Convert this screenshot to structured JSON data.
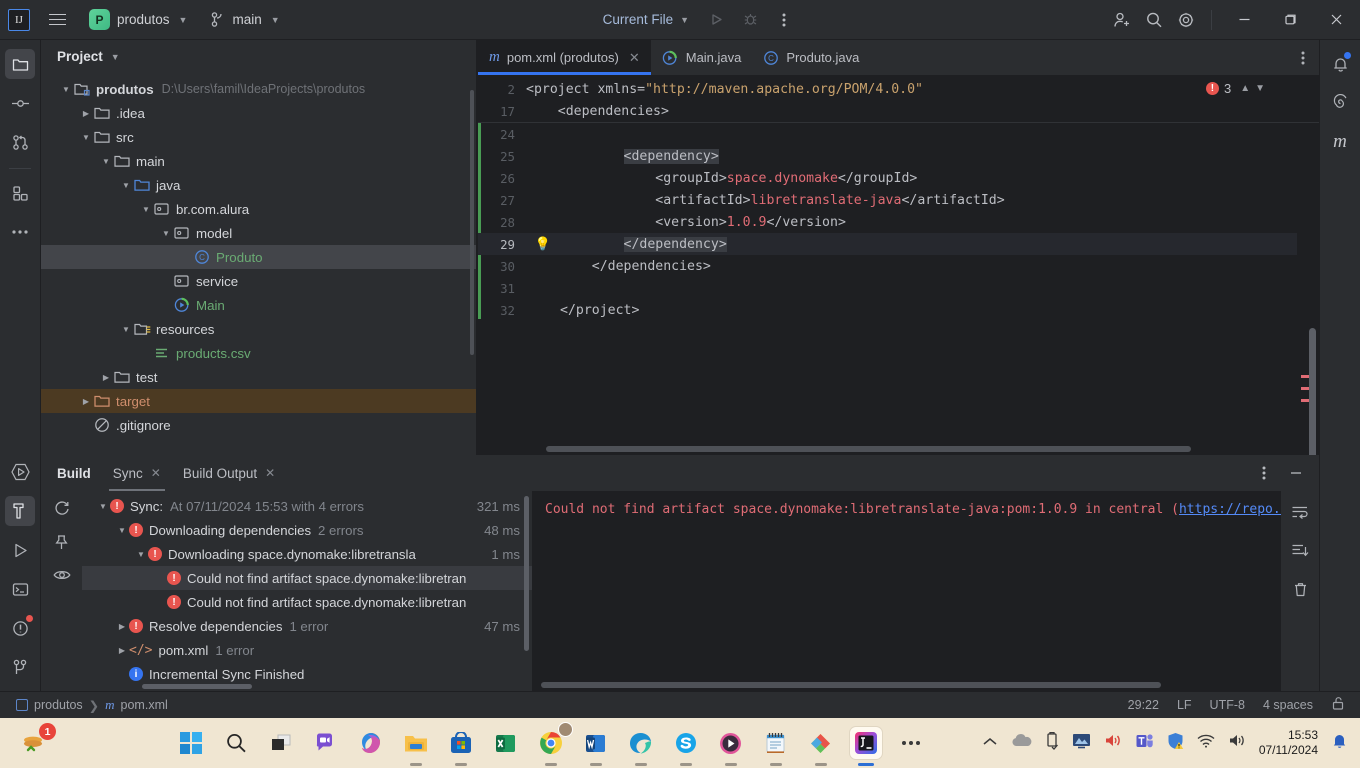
{
  "titlebar": {
    "logo": "ij-logo",
    "project_name": "produtos",
    "project_initial": "P",
    "branch": "main",
    "run_config": "Current File",
    "icons": [
      "run-icon",
      "debug-icon",
      "more-actions-icon",
      "add-collaborator-icon",
      "search-everywhere-icon",
      "settings-icon"
    ],
    "window_buttons": [
      "minimize",
      "maximize",
      "close"
    ]
  },
  "left_activity_bar": {
    "items": [
      {
        "name": "project-tool-window",
        "icon": "folder-icon",
        "active": true
      },
      {
        "name": "commit-tool-window",
        "icon": "commit-icon",
        "active": false
      },
      {
        "name": "pull-requests-tool-window",
        "icon": "branch-icon",
        "active": false
      },
      {
        "name": "structure-tool-window",
        "icon": "structure-icon",
        "active": false
      },
      {
        "name": "more-tool-windows",
        "icon": "ellipsis-icon",
        "active": false
      }
    ],
    "bottom_items": [
      {
        "name": "run-anything",
        "icon": "run-hex-icon",
        "active": false
      },
      {
        "name": "build-tool-window",
        "icon": "hammer-icon",
        "active": true
      },
      {
        "name": "run-tool-window",
        "icon": "play-icon",
        "active": false
      },
      {
        "name": "terminal-tool-window",
        "icon": "terminal-icon",
        "active": false
      },
      {
        "name": "problems-tool-window",
        "icon": "warning-icon",
        "active": false,
        "badge": true
      },
      {
        "name": "git-tool-window",
        "icon": "git-branch-icon",
        "active": false
      }
    ]
  },
  "right_activity_bar": {
    "items": [
      {
        "name": "notifications",
        "icon": "bell-icon",
        "badge": true
      },
      {
        "name": "ai-assistant",
        "icon": "spiral-icon",
        "badge": false
      },
      {
        "name": "maven-tool-window",
        "icon": "maven-m-icon",
        "badge": false
      }
    ]
  },
  "project_panel": {
    "title": "Project",
    "tree": [
      {
        "label": "produtos",
        "path": "D:\\Users\\famil\\IdeaProjects\\produtos",
        "indent": 0,
        "arrow": "down",
        "icon": "module-icon",
        "style": "bold"
      },
      {
        "label": ".idea",
        "indent": 1,
        "arrow": "right",
        "icon": "folder-icon",
        "style": "normal"
      },
      {
        "label": "src",
        "indent": 1,
        "arrow": "down",
        "icon": "folder-icon",
        "style": "normal"
      },
      {
        "label": "main",
        "indent": 2,
        "arrow": "down",
        "icon": "folder-icon",
        "style": "normal"
      },
      {
        "label": "java",
        "indent": 3,
        "arrow": "down",
        "icon": "source-root-icon",
        "style": "normal"
      },
      {
        "label": "br.com.alura",
        "indent": 4,
        "arrow": "down",
        "icon": "package-icon",
        "style": "normal"
      },
      {
        "label": "model",
        "indent": 5,
        "arrow": "down",
        "icon": "package-icon",
        "style": "normal"
      },
      {
        "label": "Produto",
        "indent": 6,
        "arrow": "none",
        "icon": "class-icon",
        "style": "green",
        "selected": true
      },
      {
        "label": "service",
        "indent": 5,
        "arrow": "none",
        "icon": "package-icon",
        "style": "normal"
      },
      {
        "label": "Main",
        "indent": 5,
        "arrow": "none",
        "icon": "runnable-class-icon",
        "style": "green"
      },
      {
        "label": "resources",
        "indent": 3,
        "arrow": "down",
        "icon": "resource-root-icon",
        "style": "normal"
      },
      {
        "label": "products.csv",
        "indent": 4,
        "arrow": "none",
        "icon": "csv-icon",
        "style": "green"
      },
      {
        "label": "test",
        "indent": 2,
        "arrow": "right",
        "icon": "folder-icon",
        "style": "normal"
      },
      {
        "label": "target",
        "indent": 1,
        "arrow": "right",
        "icon": "excluded-folder-icon",
        "style": "orange",
        "highlight": true
      },
      {
        "label": ".gitignore",
        "indent": 1,
        "arrow": "none",
        "icon": "gitignore-icon",
        "style": "normal"
      }
    ]
  },
  "editor": {
    "tabs": [
      {
        "label": "pom.xml (produtos)",
        "icon": "maven-icon",
        "active": true,
        "closable": true
      },
      {
        "label": "Main.java",
        "icon": "runnable-class-icon",
        "active": false,
        "closable": false
      },
      {
        "label": "Produto.java",
        "icon": "class-icon",
        "active": false,
        "closable": false
      }
    ],
    "error_count": "3",
    "sticky_lines": [
      {
        "num": "2",
        "text": "<project xmlns=\"http://maven.apache.org/POM/4.0.0\""
      },
      {
        "num": "17",
        "text": "    <dependencies>"
      }
    ],
    "lines": [
      {
        "num": "24",
        "text": ""
      },
      {
        "num": "25",
        "text": "        <dependency>",
        "highlight": true
      },
      {
        "num": "26",
        "text": "            <groupId>space.dynomake</groupId>"
      },
      {
        "num": "27",
        "text": "            <artifactId>libretranslate-java</artifactId>"
      },
      {
        "num": "28",
        "text": "            <version>1.0.9</version>"
      },
      {
        "num": "29",
        "text": "        </dependency>",
        "highlight": true,
        "current": true,
        "bulb": true
      },
      {
        "num": "30",
        "text": "    </dependencies>"
      },
      {
        "num": "31",
        "text": ""
      },
      {
        "num": "32",
        "text": "</project>"
      }
    ]
  },
  "build_panel": {
    "title": "Build",
    "tabs": [
      {
        "label": "Sync",
        "active": true,
        "closable": true
      },
      {
        "label": "Build Output",
        "active": false,
        "closable": true
      }
    ],
    "toolbar_icons": [
      "rerun-icon",
      "pin-icon",
      "eye-icon"
    ],
    "tree": [
      {
        "label_main": "Sync:",
        "label_muted": "At 07/11/2024 15:53 with 4 errors",
        "time": "321 ms",
        "indent": 0,
        "arrow": "down",
        "icon": "error-icon"
      },
      {
        "label_main": "Downloading dependencies",
        "label_muted": "2 errors",
        "time": "48 ms",
        "indent": 1,
        "arrow": "down",
        "icon": "error-icon"
      },
      {
        "label_main": "Downloading space.dynomake:libretransla",
        "label_muted": "",
        "time": "1 ms",
        "indent": 2,
        "arrow": "down",
        "icon": "error-icon"
      },
      {
        "label_main": "Could not find artifact space.dynomake:libretran",
        "label_muted": "",
        "time": "",
        "indent": 3,
        "arrow": "none",
        "icon": "error-icon",
        "selected": true
      },
      {
        "label_main": "Could not find artifact space.dynomake:libretran",
        "label_muted": "",
        "time": "",
        "indent": 3,
        "arrow": "none",
        "icon": "error-icon"
      },
      {
        "label_main": "Resolve dependencies",
        "label_muted": "1 error",
        "time": "47 ms",
        "indent": 1,
        "arrow": "right",
        "icon": "error-icon"
      },
      {
        "label_main": "pom.xml",
        "label_muted": "1 error",
        "time": "",
        "indent": 1,
        "arrow": "right",
        "icon": "xml-icon"
      },
      {
        "label_main": "Incremental Sync Finished",
        "label_muted": "",
        "time": "",
        "indent": 1,
        "arrow": "none",
        "icon": "info-icon"
      }
    ],
    "console": {
      "text": "Could not find artifact space.dynomake:libretranslate-java:pom:1.0.9 in central (",
      "link": "https://repo.mave",
      "tools": [
        "wrap-text-icon",
        "scroll-to-end-icon",
        "trash-icon"
      ]
    }
  },
  "status_bar": {
    "breadcrumb_project": "produtos",
    "breadcrumb_file": "pom.xml",
    "caret": "29:22",
    "line_sep": "LF",
    "encoding": "UTF-8",
    "indent": "4 spaces",
    "lock_icon": "unlocked-icon"
  },
  "taskbar": {
    "tray_badge": "1",
    "apps": [
      {
        "name": "start-button",
        "icon": "windows-logo"
      },
      {
        "name": "search-taskbar",
        "icon": "magnifier-icon"
      },
      {
        "name": "task-view",
        "icon": "task-view-icon"
      },
      {
        "name": "teams-chat",
        "icon": "chat-icon"
      },
      {
        "name": "copilot",
        "icon": "copilot-icon"
      },
      {
        "name": "file-explorer",
        "icon": "folder-icon",
        "running": true
      },
      {
        "name": "microsoft-store",
        "icon": "store-icon",
        "running": true
      },
      {
        "name": "excel",
        "icon": "excel-icon",
        "running": false
      },
      {
        "name": "chrome",
        "icon": "chrome-icon",
        "running": true
      },
      {
        "name": "word",
        "icon": "word-icon",
        "running": true
      },
      {
        "name": "edge",
        "icon": "edge-icon",
        "running": true
      },
      {
        "name": "skype",
        "icon": "skype-icon",
        "running": true
      },
      {
        "name": "media-player",
        "icon": "media-player-icon",
        "running": true
      },
      {
        "name": "notepad",
        "icon": "notepad-icon",
        "running": true
      },
      {
        "name": "paint",
        "icon": "paint-icon",
        "running": true
      },
      {
        "name": "intellij-idea",
        "icon": "intellij-icon",
        "running": true,
        "active": true
      },
      {
        "name": "show-more",
        "icon": "ellipsis-icon"
      }
    ],
    "tray": [
      "show-hidden-icons",
      "onedrive-icon",
      "usb-icon",
      "display-icon",
      "volume-mute-icon",
      "teams-icon",
      "defender-icon",
      "wifi-icon",
      "speaker-icon"
    ],
    "clock_time": "15:53",
    "clock_date": "07/11/2024",
    "notification_icon": "bell-icon"
  }
}
